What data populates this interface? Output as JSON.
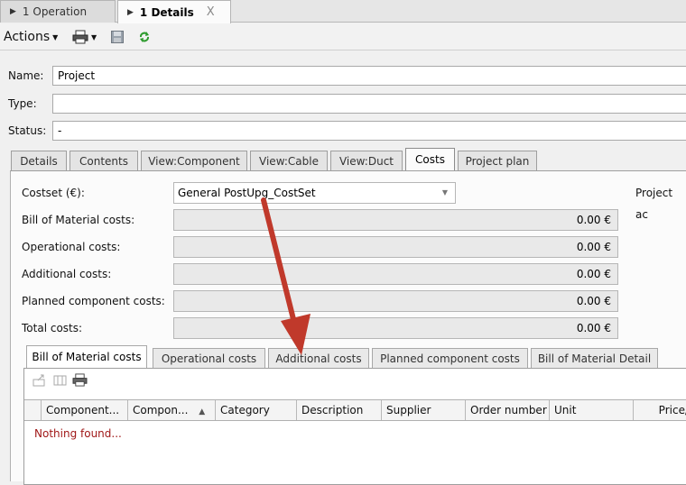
{
  "doc_tabs": [
    {
      "label": "1 Operation"
    },
    {
      "label": "1 Details",
      "close": "X"
    }
  ],
  "toolbar": {
    "actions_label": "Actions"
  },
  "form": {
    "name_label": "Name:",
    "name_value": "Project",
    "type_label": "Type:",
    "type_value": "",
    "status_label": "Status:",
    "status_value": "-"
  },
  "tabs": [
    "Details",
    "Contents",
    "View:Component",
    "View:Cable",
    "View:Duct",
    "Costs",
    "Project plan"
  ],
  "costs": {
    "costset_label": "Costset (€):",
    "costset_value": "General PostUpg_CostSet",
    "project_label": "Project ac",
    "rows": [
      {
        "label": "Bill of Material costs:",
        "value": "0.00 €"
      },
      {
        "label": "Operational costs:",
        "value": "0.00 €"
      },
      {
        "label": "Additional costs:",
        "value": "0.00 €"
      },
      {
        "label": "Planned component costs:",
        "value": "0.00 €"
      },
      {
        "label": "Total costs:",
        "value": "0.00 €"
      }
    ]
  },
  "inner_tabs": [
    "Bill of Material costs",
    "Operational costs",
    "Additional costs",
    "Planned component costs",
    "Bill of Material Detail"
  ],
  "grid": {
    "columns": [
      "Component...",
      "Compon...",
      "Category",
      "Description",
      "Supplier",
      "Order number",
      "Unit",
      "Price/"
    ],
    "empty_message": "Nothing found..."
  },
  "colors": {
    "arrow": "#c0392b",
    "empty_text": "#a01818"
  }
}
